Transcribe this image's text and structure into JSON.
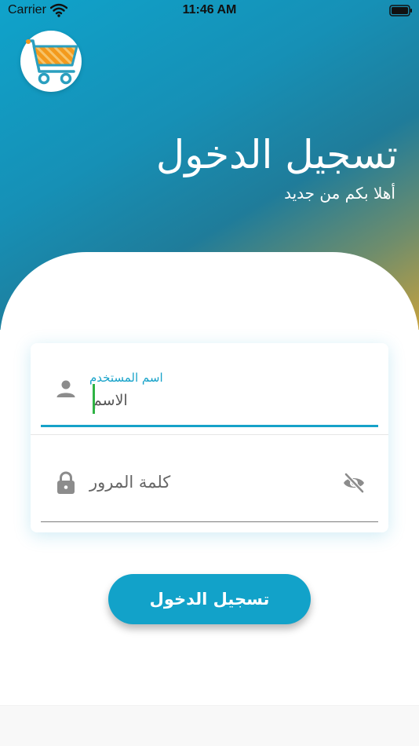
{
  "status_bar": {
    "carrier": "Carrier",
    "time": "11:46 AM",
    "wifi_icon": "wifi-icon",
    "battery_icon": "battery-icon"
  },
  "header": {
    "logo_icon": "shopping-cart-icon",
    "title": "تسجيل الدخول",
    "subtitle": "أهلا بكم من جديد"
  },
  "form": {
    "username": {
      "label": "اسم المستخدم",
      "value": "الاسم",
      "icon": "person-icon"
    },
    "password": {
      "placeholder": "كلمة المرور",
      "icon": "lock-icon",
      "toggle_icon": "eye-off-icon"
    }
  },
  "actions": {
    "login_label": "تسجيل الدخول"
  },
  "colors": {
    "primary": "#12a2c9",
    "accent_gold": "#c7a23d",
    "cursor": "#2fb344"
  }
}
